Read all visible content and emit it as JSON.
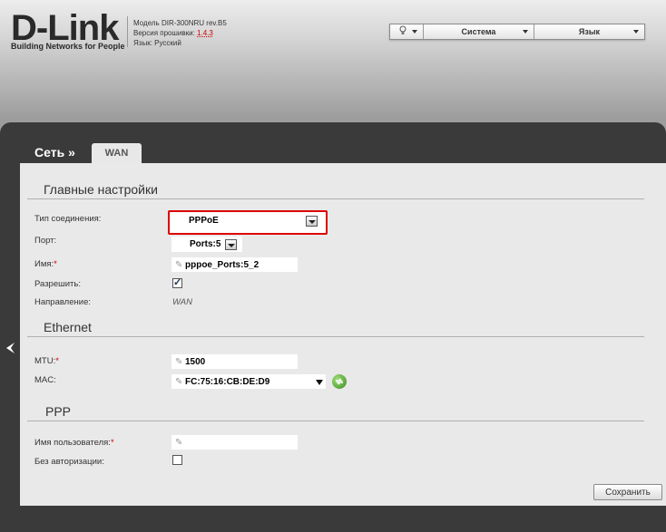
{
  "header": {
    "logo_text": "D-Link",
    "logo_tagline": "Building Networks for People",
    "model_line": "Модель DIR-300NRU rev.B5",
    "firmware_label": "Версия прошивки: ",
    "firmware_version": "1.4.3",
    "language_line": "Язык: Русский"
  },
  "topbar": {
    "hint_icon": "lightbulb-icon",
    "system_label": "Система",
    "language_label": "Язык"
  },
  "breadcrumb": "Сеть »",
  "tab": "WAN",
  "sections": {
    "main": "Главные настройки",
    "ethernet": "Ethernet",
    "ppp": "PPP"
  },
  "fields": {
    "connection_type_label": "Тип соединения:",
    "connection_type_value": "PPPoE",
    "port_label": "Порт:",
    "port_value": "Ports:5",
    "name_label": "Имя:",
    "name_value": "pppoe_Ports:5_2",
    "enable_label": "Разрешить:",
    "direction_label": "Направление:",
    "direction_value": "WAN",
    "mtu_label": "MTU:",
    "mtu_value": "1500",
    "mac_label": "MAC:",
    "mac_value": "FC:75:16:CB:DE:D9",
    "username_label": "Имя пользователя:",
    "username_value": "",
    "no_auth_label": "Без авторизации:"
  },
  "required_mark": "*",
  "save_label": "Сохранить",
  "colors": {
    "highlight": "#dd0000",
    "required": "#cc0000",
    "panel": "#3a3a3a"
  }
}
